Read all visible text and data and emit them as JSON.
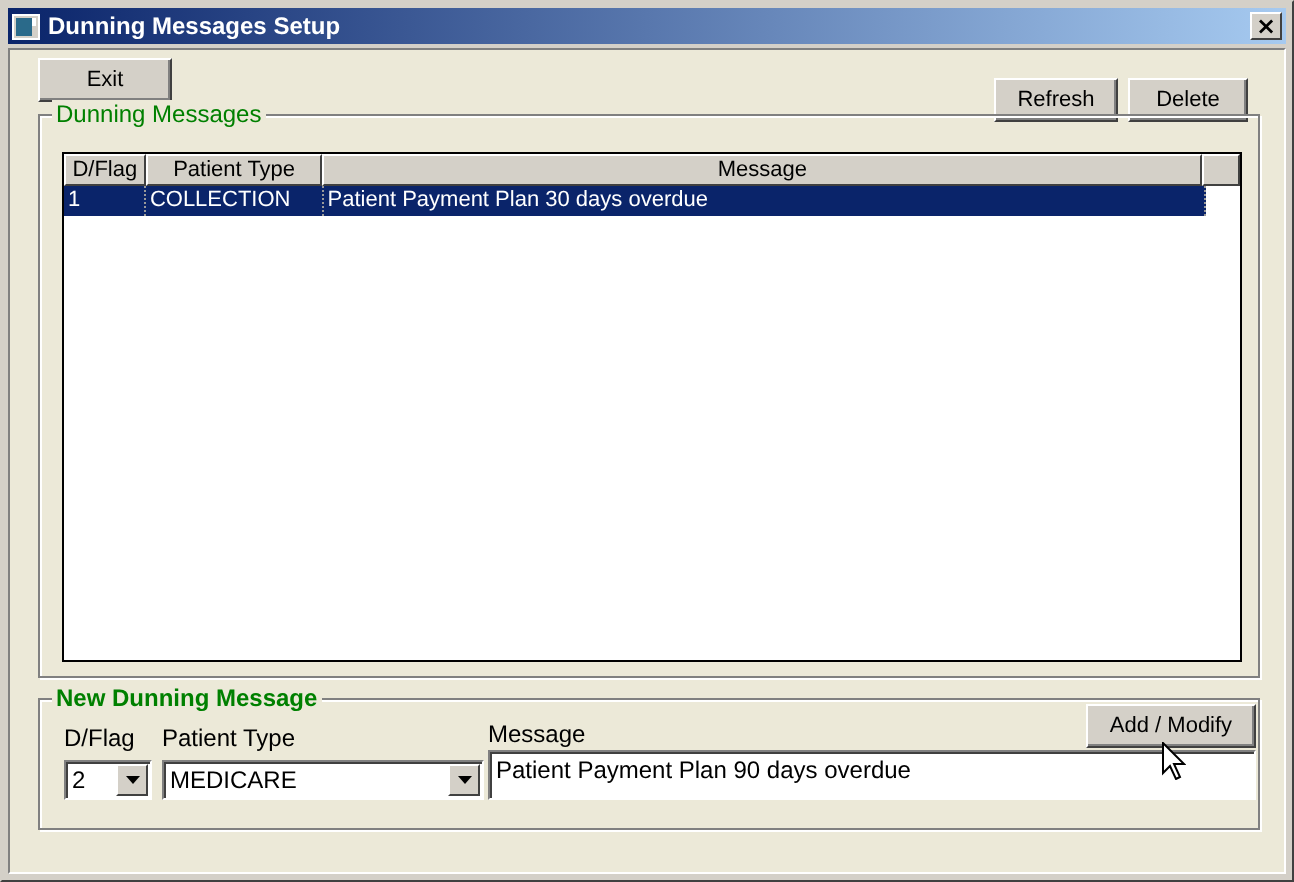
{
  "window": {
    "title": "Dunning Messages Setup",
    "close": "×"
  },
  "buttons": {
    "exit": "Exit",
    "refresh": "Refresh",
    "delete": "Delete"
  },
  "list_group": {
    "title": "Dunning Messages",
    "columns": [
      "D/Flag",
      "Patient Type",
      "Message"
    ],
    "rows": [
      {
        "cells": [
          "1",
          "COLLECTION",
          "Patient Payment Plan 30 days overdue"
        ],
        "selected": true
      }
    ]
  },
  "new_group": {
    "title": "New Dunning Message",
    "dflag": {
      "label": "D/Flag",
      "value": "2"
    },
    "patient_type": {
      "label": "Patient Type",
      "value": "MEDICARE"
    },
    "message": {
      "label": "Message",
      "value": "Patient Payment Plan 90 days overdue"
    },
    "add_button": "Add / Modify"
  }
}
